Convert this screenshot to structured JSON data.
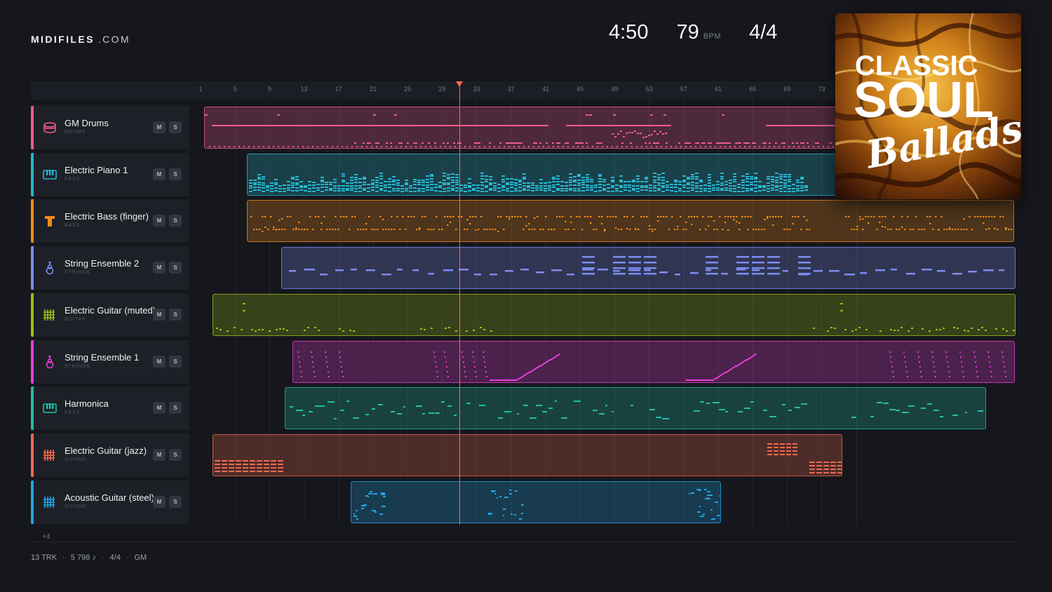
{
  "brand": {
    "name": "MIDIFILES",
    "domain": ".COM"
  },
  "header": {
    "duration": "4:50",
    "bpm": "79",
    "bpm_unit": "BPM",
    "time_signature": "4/4"
  },
  "ruler": {
    "bars": [
      "1",
      "5",
      "9",
      "13",
      "17",
      "21",
      "25",
      "29",
      "33",
      "37",
      "41",
      "45",
      "49",
      "53",
      "57",
      "61",
      "65",
      "69",
      "73"
    ]
  },
  "playhead_bar": 31,
  "tracks": [
    {
      "name": "GM Drums",
      "category": "DRUMS",
      "color": "#ee5c8f",
      "icon": "drum-icon",
      "mute": "M",
      "solo": "S"
    },
    {
      "name": "Electric Piano 1",
      "category": "KEYS",
      "color": "#25b7d0",
      "icon": "piano-icon",
      "mute": "M",
      "solo": "S"
    },
    {
      "name": "Electric Bass (finger)",
      "category": "BASS",
      "color": "#f08a1c",
      "icon": "bass-icon",
      "mute": "M",
      "solo": "S"
    },
    {
      "name": "String Ensemble 2",
      "category": "STRINGS",
      "color": "#7b8cf0",
      "icon": "violin-icon",
      "mute": "M",
      "solo": "S"
    },
    {
      "name": "Electric Guitar (muted)",
      "category": "GUITAR",
      "color": "#9cbf18",
      "icon": "guitar-fret-icon",
      "mute": "M",
      "solo": "S"
    },
    {
      "name": "String Ensemble 1",
      "category": "STRINGS",
      "color": "#e63fd8",
      "icon": "violin-icon",
      "mute": "M",
      "solo": "S"
    },
    {
      "name": "Harmonica",
      "category": "KEYS",
      "color": "#21bfa6",
      "icon": "piano-icon",
      "mute": "M",
      "solo": "S"
    },
    {
      "name": "Electric Guitar (jazz)",
      "category": "GUITAR",
      "color": "#f06a50",
      "icon": "guitar-fret-icon",
      "mute": "M",
      "solo": "S"
    },
    {
      "name": "Acoustic Guitar (steel)",
      "category": "GUITAR",
      "color": "#20a4e8",
      "icon": "guitar-fret-icon",
      "mute": "M",
      "solo": "S"
    }
  ],
  "more_tracks": "+4",
  "footer": {
    "tracks": "13 TRK",
    "notes": "5 798 ♪",
    "time_signature": "4/4",
    "standard": "GM"
  },
  "album": {
    "line1": "CLASSIC",
    "line2": "SOUL",
    "line3": "Ballads"
  }
}
